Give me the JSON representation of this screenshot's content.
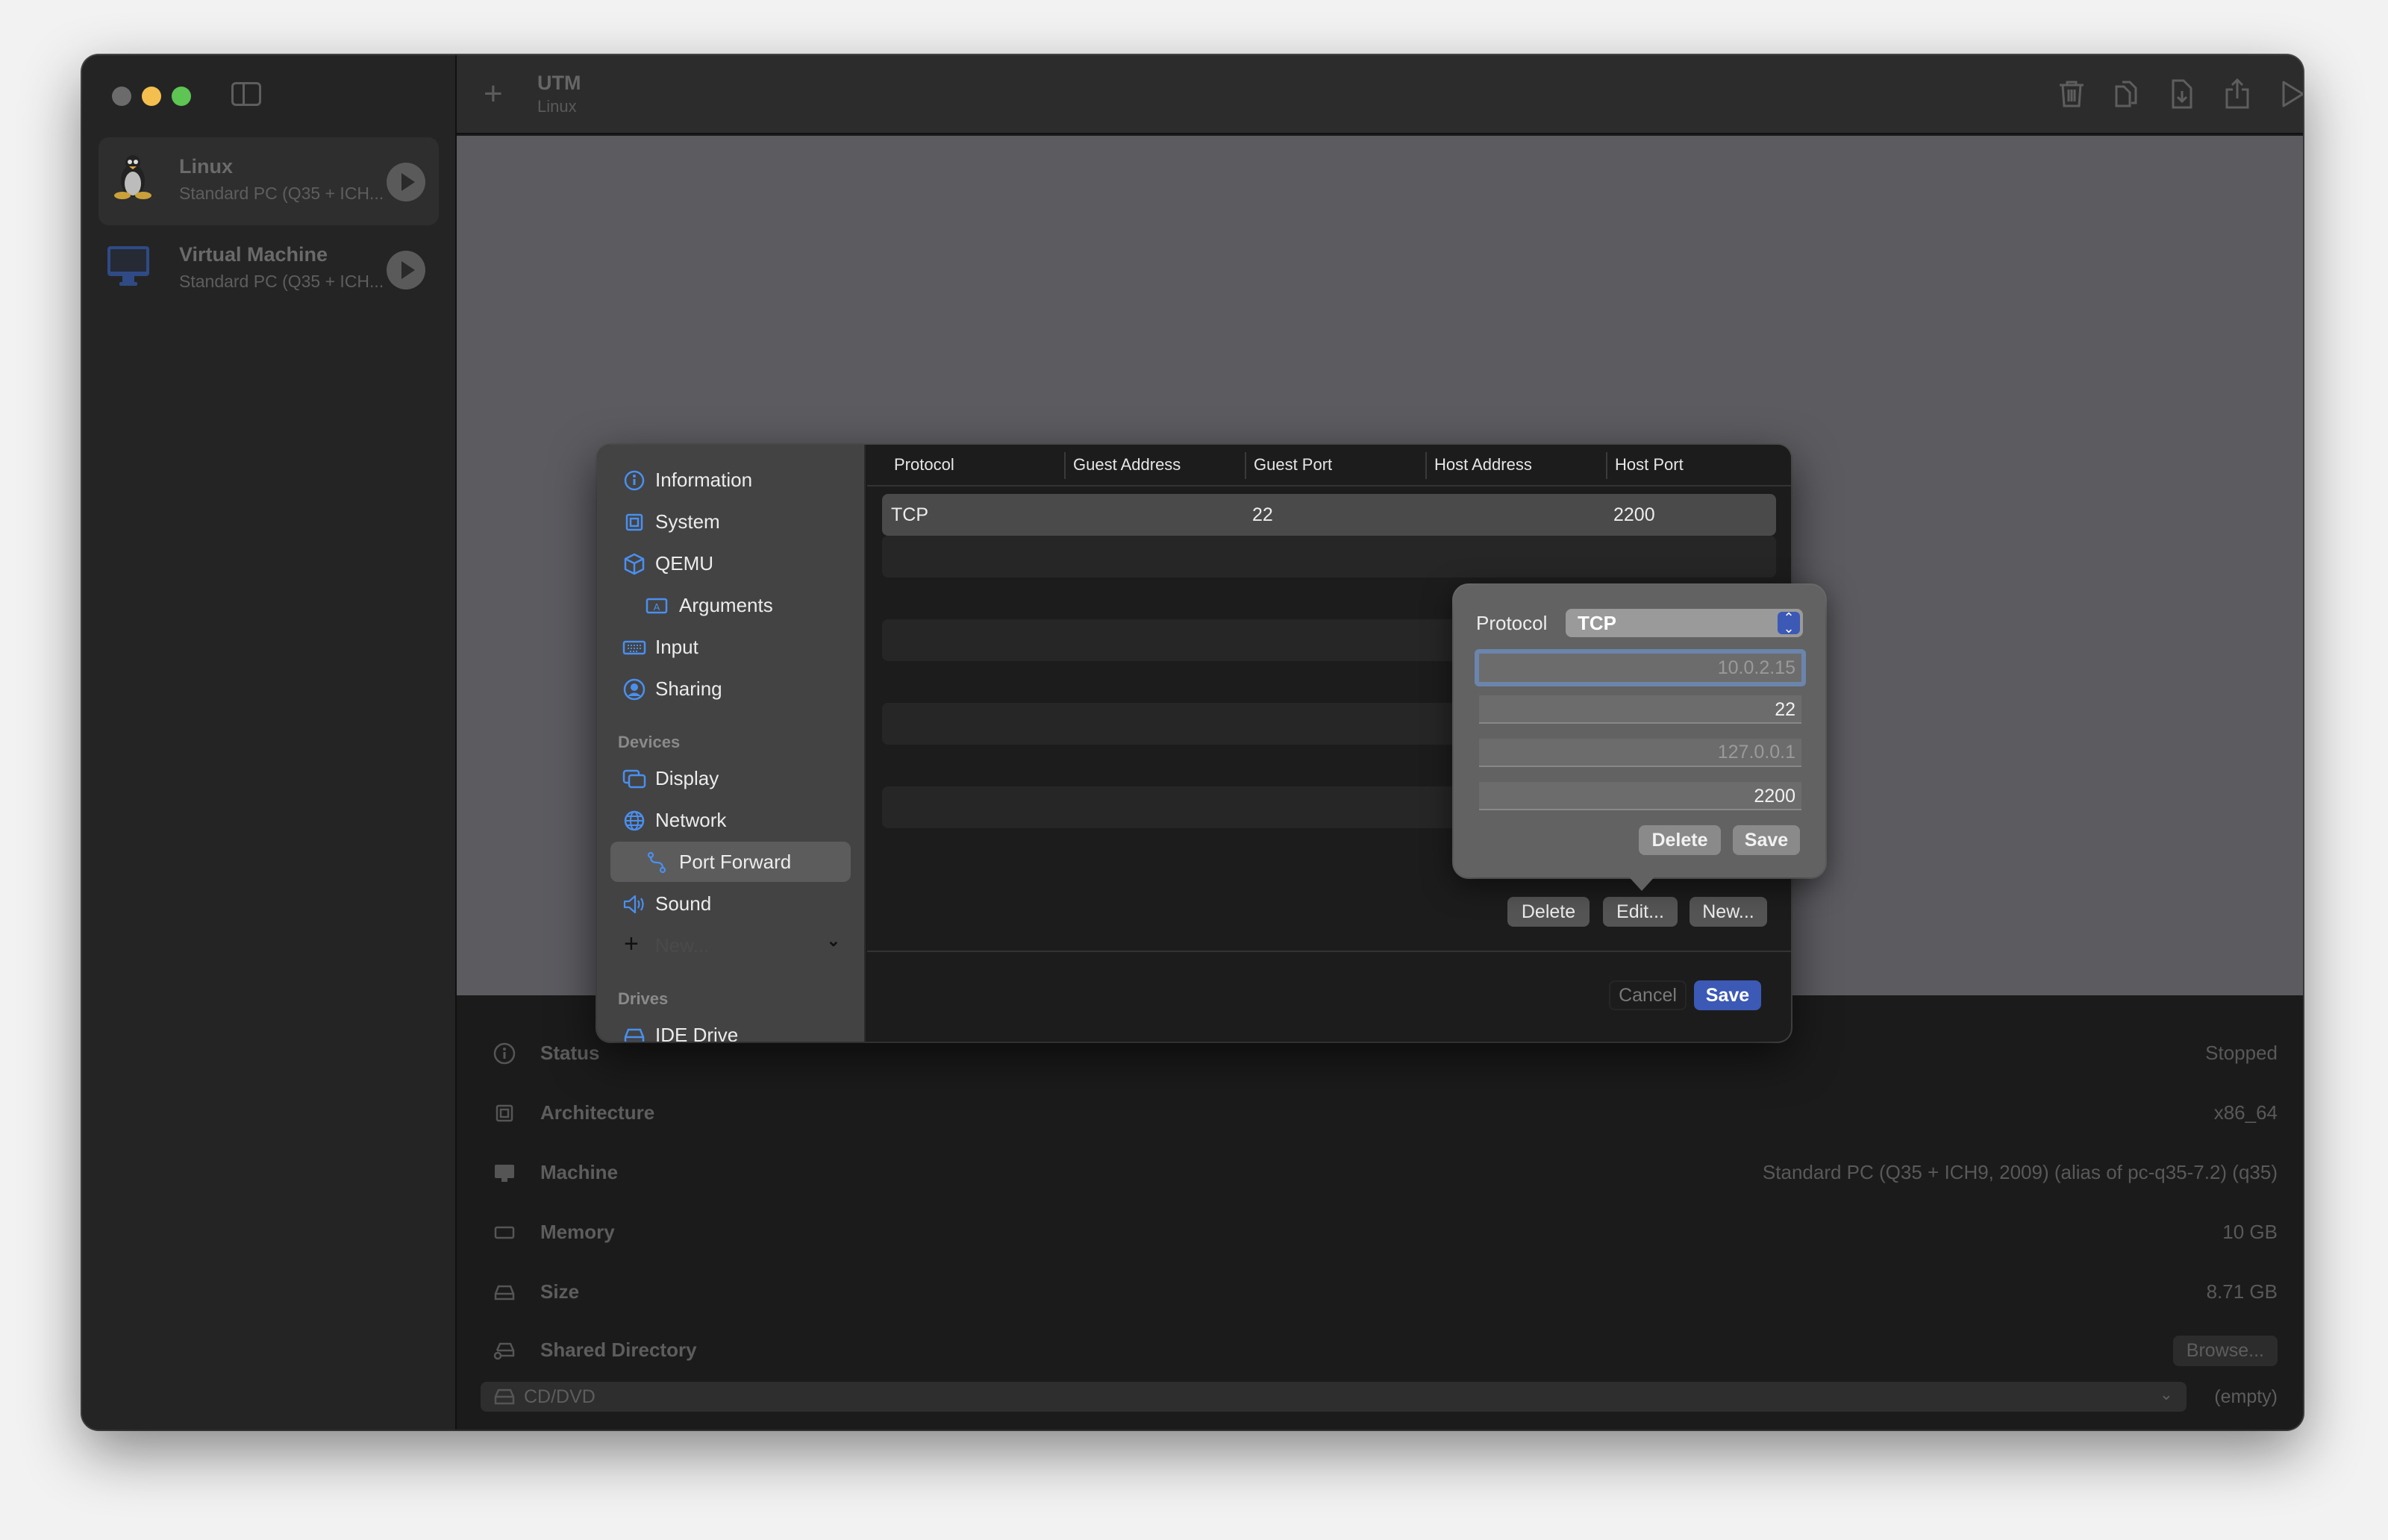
{
  "window": {
    "traffic_lights": {
      "close": "#6b6b6b",
      "minimize": "#f4bf4f",
      "zoom": "#5ec454"
    }
  },
  "sidebar": {
    "vms": [
      {
        "name": "Linux",
        "subtitle": "Standard PC (Q35 + ICH...",
        "icon": "linux-penguin-icon",
        "selected": true
      },
      {
        "name": "Virtual Machine",
        "subtitle": "Standard PC (Q35 + ICH...",
        "icon": "monitor-icon",
        "selected": false
      }
    ]
  },
  "toolbar": {
    "add_label": "+",
    "title": "UTM",
    "subtitle": "Linux",
    "icons": [
      "trash-icon",
      "clone-icon",
      "download-file-icon",
      "share-icon",
      "play-icon",
      "settings-sliders-icon"
    ]
  },
  "info": {
    "rows": [
      {
        "icon": "info-icon",
        "label": "Status",
        "value": "Stopped"
      },
      {
        "icon": "cpu-icon",
        "label": "Architecture",
        "value": "x86_64"
      },
      {
        "icon": "monitor-icon",
        "label": "Machine",
        "value": "Standard PC (Q35 + ICH9, 2009) (alias of pc-q35-7.2) (q35)"
      },
      {
        "icon": "memory-icon",
        "label": "Memory",
        "value": "10 GB"
      },
      {
        "icon": "drive-icon",
        "label": "Size",
        "value": "8.71 GB"
      },
      {
        "icon": "shared-drive-icon",
        "label": "Shared Directory",
        "value": ""
      }
    ],
    "browse_label": "Browse...",
    "cd_drive": {
      "label": "CD/DVD",
      "value": "(empty)"
    }
  },
  "dialog": {
    "nav": {
      "items": [
        {
          "label": "Information",
          "icon": "info-icon",
          "indent": false,
          "active": false
        },
        {
          "label": "System",
          "icon": "cpu-icon",
          "indent": false,
          "active": false
        },
        {
          "label": "QEMU",
          "icon": "cube-icon",
          "indent": false,
          "active": false
        },
        {
          "label": "Arguments",
          "icon": "text-field-icon",
          "indent": true,
          "active": false
        },
        {
          "label": "Input",
          "icon": "keyboard-icon",
          "indent": false,
          "active": false
        },
        {
          "label": "Sharing",
          "icon": "person-circle-icon",
          "indent": false,
          "active": false
        }
      ],
      "devices_header": "Devices",
      "devices": [
        {
          "label": "Display",
          "icon": "display-icon",
          "indent": false,
          "active": false
        },
        {
          "label": "Network",
          "icon": "globe-icon",
          "indent": false,
          "active": false
        },
        {
          "label": "Port Forward",
          "icon": "port-forward-icon",
          "indent": true,
          "active": true
        },
        {
          "label": "Sound",
          "icon": "speaker-icon",
          "indent": false,
          "active": false
        }
      ],
      "new_device_label": "New...",
      "drives_header": "Drives",
      "drives": [
        {
          "label": "IDE Drive",
          "icon": "drive-icon"
        }
      ]
    },
    "table": {
      "columns": [
        "Protocol",
        "Guest Address",
        "Guest Port",
        "Host Address",
        "Host Port"
      ],
      "rows": [
        {
          "protocol": "TCP",
          "guest_address": "",
          "guest_port": "22",
          "host_address": "",
          "host_port": "2200"
        }
      ]
    },
    "buttons": {
      "delete": "Delete",
      "edit": "Edit...",
      "new": "New...",
      "cancel": "Cancel",
      "save": "Save"
    },
    "accent": "#3b59b5"
  },
  "popover": {
    "protocol_label": "Protocol",
    "protocol_value": "TCP",
    "guest_address_placeholder": "10.0.2.15",
    "guest_port": "22",
    "host_address_placeholder": "127.0.0.1",
    "host_port": "2200",
    "delete_label": "Delete",
    "save_label": "Save"
  }
}
